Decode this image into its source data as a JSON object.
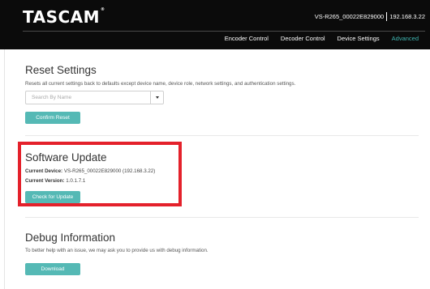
{
  "header": {
    "brand": "TASCAM",
    "brand_mark": "®",
    "device_name": "VS-R265_00022E829000",
    "device_ip": "192.168.3.22"
  },
  "nav": {
    "items": [
      {
        "label": "Encoder Control",
        "active": false
      },
      {
        "label": "Decoder Control",
        "active": false
      },
      {
        "label": "Device Settings",
        "active": false
      },
      {
        "label": "Advanced",
        "active": true
      }
    ],
    "active_color": "#3fb4b0"
  },
  "reset": {
    "title": "Reset Settings",
    "description": "Resets all current settings back to defaults except device name, device role, network settings, and authentication settings.",
    "search_placeholder": "Search By Name",
    "confirm_label": "Confirm Reset"
  },
  "software_update": {
    "title": "Software Update",
    "current_device_label": "Current Device:",
    "current_device_value": "VS-R265_00022E829000 (192.168.3.22)",
    "current_version_label": "Current Version:",
    "current_version_value": "1.0.1.7.1",
    "check_label": "Check for Update",
    "highlight_color": "#e4212b"
  },
  "debug": {
    "title": "Debug Information",
    "description": "To better help with an issue, we may ask you to provide us with debug information.",
    "download_label": "Download"
  },
  "colors": {
    "header_bg": "#0b0b0b",
    "button_bg": "#55b9b5"
  }
}
